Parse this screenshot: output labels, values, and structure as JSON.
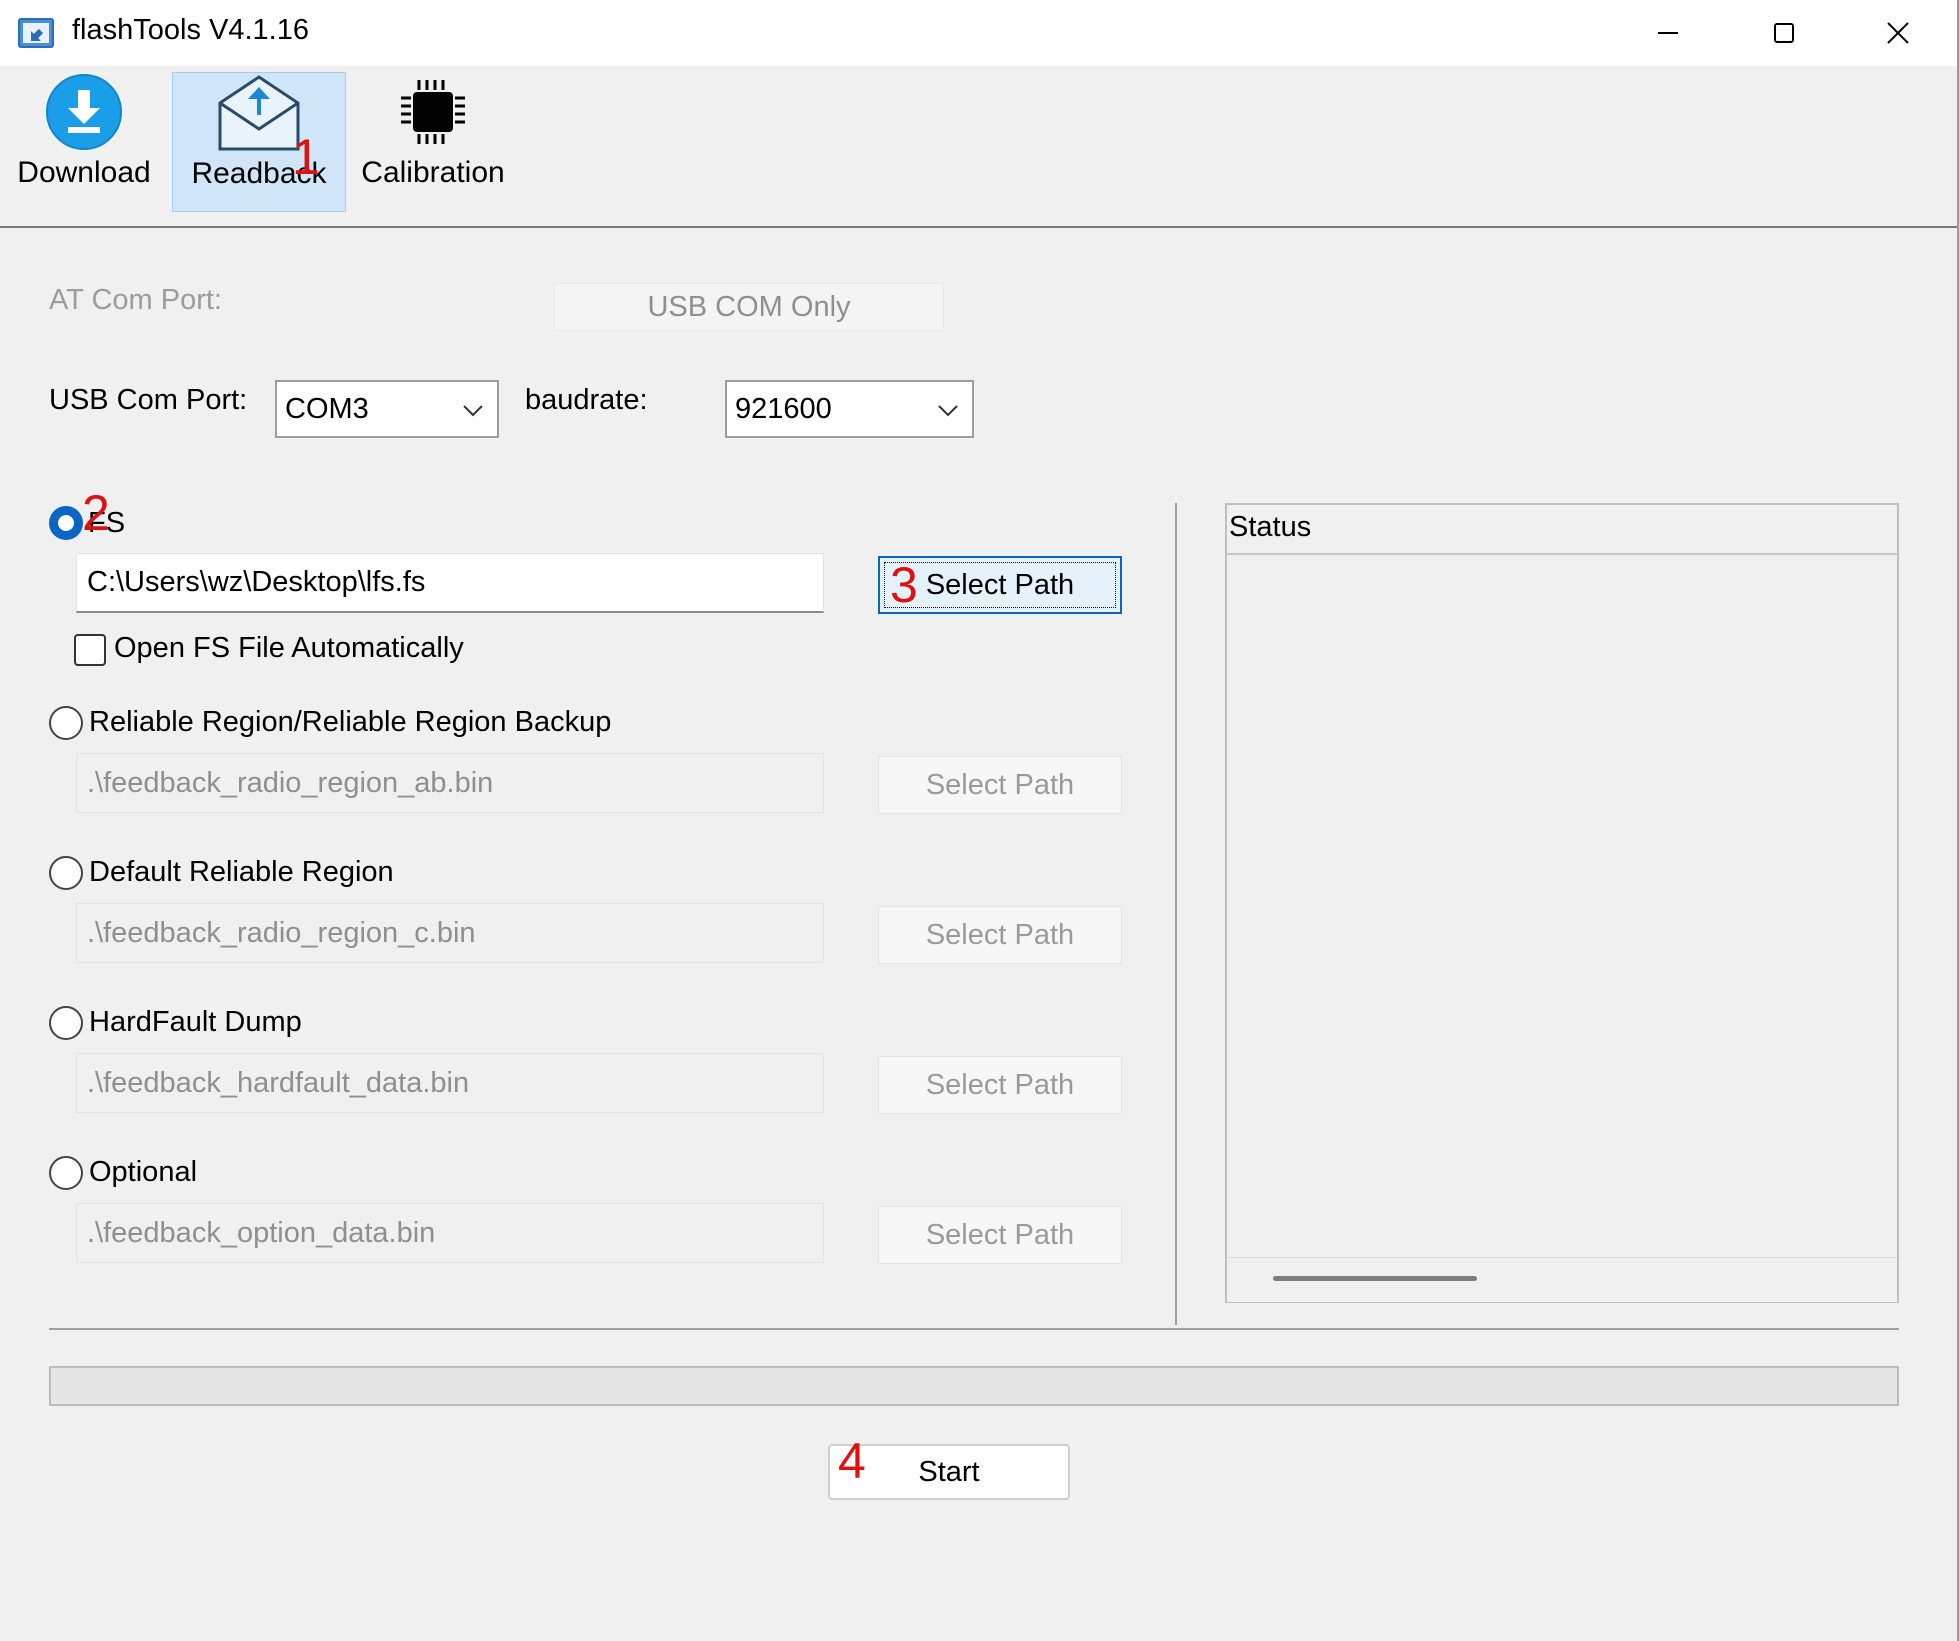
{
  "window": {
    "title": "flashTools V4.1.16"
  },
  "toolbar": {
    "tabs": [
      {
        "label": "Download",
        "icon": "download-icon",
        "active": false
      },
      {
        "label": "Readback",
        "icon": "envelope-upload-icon",
        "active": true
      },
      {
        "label": "Calibration",
        "icon": "chip-icon",
        "active": false
      }
    ]
  },
  "settings": {
    "at_com_port_label": "AT Com Port:",
    "usb_com_only_label": "USB COM Only",
    "usb_com_port_label": "USB Com Port:",
    "usb_com_port_value": "COM3",
    "baudrate_label": "baudrate:",
    "baudrate_value": "921600"
  },
  "options": {
    "fs": {
      "label": "FS",
      "checked": true,
      "path": "C:\\Users\\wz\\Desktop\\lfs.fs",
      "select_label": "Select Path",
      "auto_open_label": "Open FS File Automatically"
    },
    "reliable": {
      "label": "Reliable Region/Reliable Region Backup",
      "path": ".\\feedback_radio_region_ab.bin",
      "select_label": "Select Path"
    },
    "default_reliable": {
      "label": "Default Reliable Region",
      "path": ".\\feedback_radio_region_c.bin",
      "select_label": "Select Path"
    },
    "hardfault": {
      "label": "HardFault Dump",
      "path": ".\\feedback_hardfault_data.bin",
      "select_label": "Select Path"
    },
    "optional": {
      "label": "Optional",
      "path": ".\\feedback_option_data.bin",
      "select_label": "Select Path"
    }
  },
  "status": {
    "header": "Status"
  },
  "progress": {
    "value": 0
  },
  "actions": {
    "start_label": "Start"
  },
  "annotations": [
    "1",
    "2",
    "3",
    "4"
  ],
  "colors": {
    "accent": "#0a66c2",
    "annotation": "#e01010",
    "active_tab_bg": "#d0e6f8"
  }
}
